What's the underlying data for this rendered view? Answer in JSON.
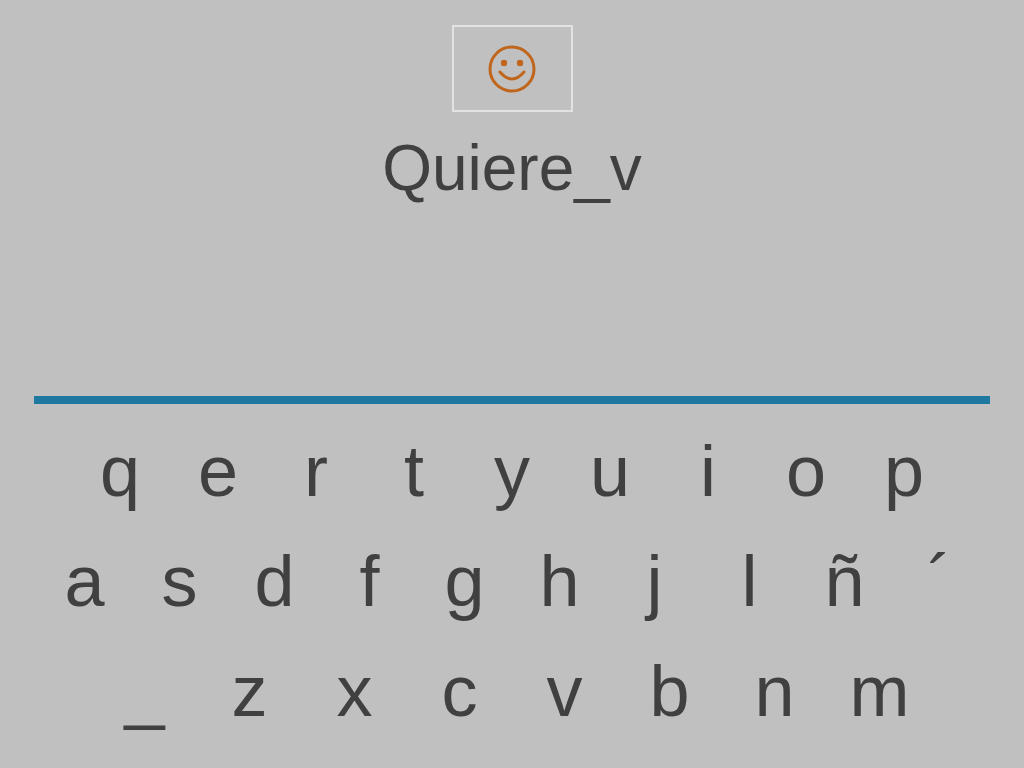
{
  "typed_text": "Quiere_v",
  "keyboard": {
    "rows": [
      [
        "q",
        "e",
        "r",
        "t",
        "y",
        "u",
        "i",
        "o",
        "p"
      ],
      [
        "a",
        "s",
        "d",
        "f",
        "g",
        "h",
        "j",
        "l",
        "ñ",
        "´"
      ],
      [
        "_",
        "z",
        "x",
        "c",
        "v",
        "b",
        "n",
        "m"
      ]
    ]
  }
}
